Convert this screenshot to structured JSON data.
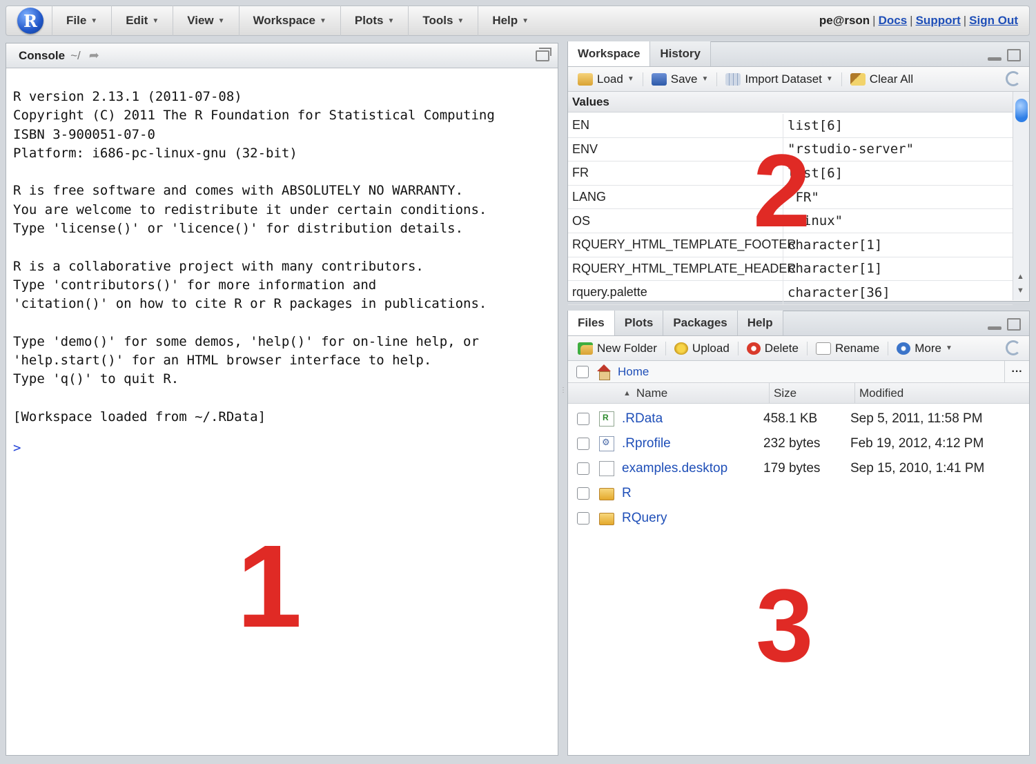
{
  "menubar": {
    "logo": "R",
    "items": [
      "File",
      "Edit",
      "View",
      "Workspace",
      "Plots",
      "Tools",
      "Help"
    ],
    "user": "pe@rson",
    "links": [
      "Docs",
      "Support",
      "Sign Out"
    ]
  },
  "console": {
    "title": "Console",
    "path": "~/",
    "lines": [
      "R version 2.13.1 (2011-07-08)",
      "Copyright (C) 2011 The R Foundation for Statistical Computing",
      "ISBN 3-900051-07-0",
      "Platform: i686-pc-linux-gnu (32-bit)",
      "",
      "R is free software and comes with ABSOLUTELY NO WARRANTY.",
      "You are welcome to redistribute it under certain conditions.",
      "Type 'license()' or 'licence()' for distribution details.",
      "",
      "R is a collaborative project with many contributors.",
      "Type 'contributors()' for more information and",
      "'citation()' on how to cite R or R packages in publications.",
      "",
      "Type 'demo()' for some demos, 'help()' for on-line help, or",
      "'help.start()' for an HTML browser interface to help.",
      "Type 'q()' to quit R.",
      "",
      "[Workspace loaded from ~/.RData]"
    ],
    "prompt": ">",
    "annotation": "1"
  },
  "workspace": {
    "tabs": [
      "Workspace",
      "History"
    ],
    "toolbar": [
      "Load",
      "Save",
      "Import Dataset",
      "Clear All"
    ],
    "section": "Values",
    "rows": [
      {
        "name": "EN",
        "value": "list[6]"
      },
      {
        "name": "ENV",
        "value": "\"rstudio-server\""
      },
      {
        "name": "FR",
        "value": "list[6]"
      },
      {
        "name": "LANG",
        "value": "\"FR\""
      },
      {
        "name": "OS",
        "value": "\"linux\""
      },
      {
        "name": "RQUERY_HTML_TEMPLATE_FOOTER",
        "value": "character[1]"
      },
      {
        "name": "RQUERY_HTML_TEMPLATE_HEADER",
        "value": "character[1]"
      },
      {
        "name": "rquery.palette",
        "value": "character[36]"
      }
    ],
    "annotation": "2"
  },
  "files": {
    "tabs": [
      "Files",
      "Plots",
      "Packages",
      "Help"
    ],
    "toolbar": [
      "New Folder",
      "Upload",
      "Delete",
      "Rename",
      "More"
    ],
    "home": "Home",
    "columns": [
      "Name",
      "Size",
      "Modified"
    ],
    "rows": [
      {
        "name": ".RData",
        "size": "458.1 KB",
        "modified": "Sep 5, 2011, 11:58 PM",
        "icon": "rdata-file-icon"
      },
      {
        "name": ".Rprofile",
        "size": "232 bytes",
        "modified": "Feb 19, 2012, 4:12 PM",
        "icon": "rprofile-file-icon"
      },
      {
        "name": "examples.desktop",
        "size": "179 bytes",
        "modified": "Sep 15, 2010, 1:41 PM",
        "icon": "document-icon"
      },
      {
        "name": "R",
        "size": "",
        "modified": "",
        "icon": "folder-icon"
      },
      {
        "name": "RQuery",
        "size": "",
        "modified": "",
        "icon": "folder-icon"
      }
    ],
    "annotation": "3"
  },
  "colors": {
    "annotation": "#e02a25",
    "link": "#1f4fb8",
    "prompt": "#2545d8"
  }
}
